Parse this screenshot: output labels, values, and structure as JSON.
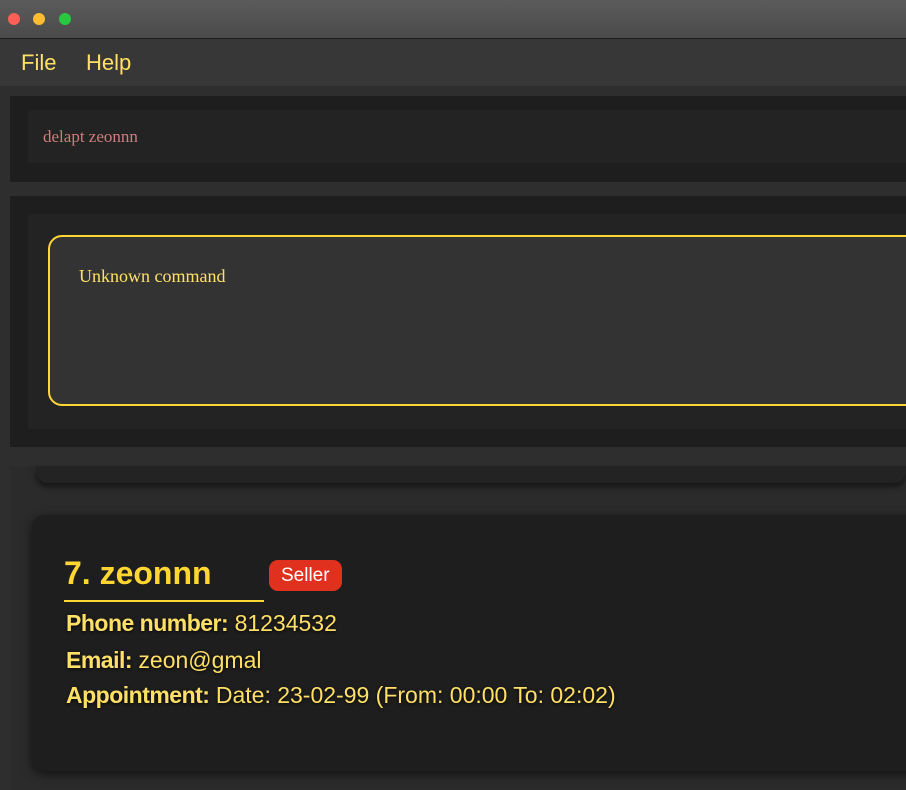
{
  "window": {
    "traffic_lights": [
      {
        "name": "close",
        "color": "#fe5f57"
      },
      {
        "name": "minimize",
        "color": "#febc2e"
      },
      {
        "name": "zoom",
        "color": "#28c840"
      }
    ]
  },
  "menu": {
    "file": "File",
    "help": "Help"
  },
  "command": {
    "value": "delapt zeonnn"
  },
  "result": {
    "message": "Unknown command"
  },
  "person": {
    "title": "7. zeonnn",
    "tag": "Seller",
    "phone_label": "Phone number:",
    "phone": "81234532",
    "email_label": "Email:",
    "email": "zeon@gmal",
    "appointment_label": "Appointment:",
    "appointment": "Date: 23-02-99 (From: 00:00 To: 02:02)"
  },
  "colors": {
    "accent": "#ffd632",
    "tag_bg": "#e0301e",
    "command_text": "#d07c7c"
  }
}
